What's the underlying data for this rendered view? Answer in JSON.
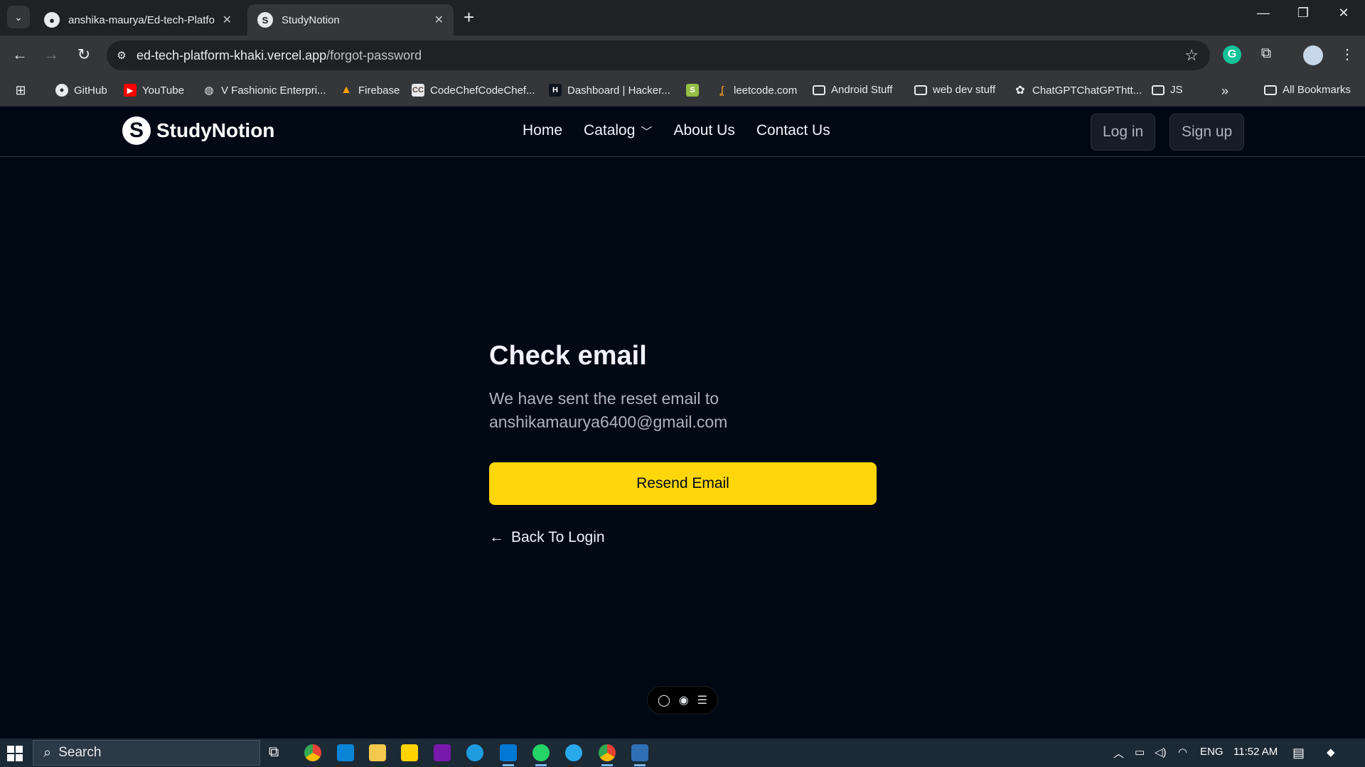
{
  "browser": {
    "tabs": [
      {
        "title": "anshika-maurya/Ed-tech-Platfo",
        "favicon": "github-icon",
        "active": false
      },
      {
        "title": "StudyNotion",
        "favicon": "studynotion-icon",
        "active": true
      }
    ],
    "new_tab_label": "+",
    "url_host": "ed-tech-platform-khaki.vercel.app",
    "url_path": "/forgot-password",
    "bookmarks": [
      {
        "label": "GitHub",
        "icon": "github-icon"
      },
      {
        "label": "YouTube",
        "icon": "youtube-icon"
      },
      {
        "label": "V Fashionic Enterpri...",
        "icon": "globe-icon"
      },
      {
        "label": "Firebase",
        "icon": "firebase-icon"
      },
      {
        "label": "CodeChefCodeChef...",
        "icon": "codechef-icon"
      },
      {
        "label": "Dashboard | Hacker...",
        "icon": "hackerrank-icon"
      },
      {
        "label": "",
        "icon": "shopify-icon"
      },
      {
        "label": "leetcode.com",
        "icon": "leetcode-icon"
      },
      {
        "label": "Android Stuff",
        "icon": "folder-icon"
      },
      {
        "label": "web dev stuff",
        "icon": "folder-icon"
      },
      {
        "label": "ChatGPTChatGPThtt...",
        "icon": "chatgpt-icon"
      },
      {
        "label": "JS",
        "icon": "folder-icon"
      }
    ],
    "all_bookmarks": "All Bookmarks"
  },
  "site": {
    "logo_letter": "S",
    "logo_name": "StudyNotion",
    "nav": {
      "home": "Home",
      "catalog": "Catalog",
      "about": "About Us",
      "contact": "Contact Us"
    },
    "login": "Log in",
    "signup": "Sign up"
  },
  "main": {
    "heading": "Check email",
    "message_line1": "We have sent the reset email to",
    "message_line2": "anshikamaurya6400@gmail.com",
    "resend_button": "Resend Email",
    "back_link": "Back To Login"
  },
  "taskbar": {
    "search_placeholder": "Search",
    "language": "ENG",
    "time": "11:52 AM"
  },
  "colors": {
    "page_bg": "#000814",
    "accent_yellow": "#FFD60A",
    "text_primary": "#F1F2FF",
    "text_secondary": "#AFB2BF"
  }
}
